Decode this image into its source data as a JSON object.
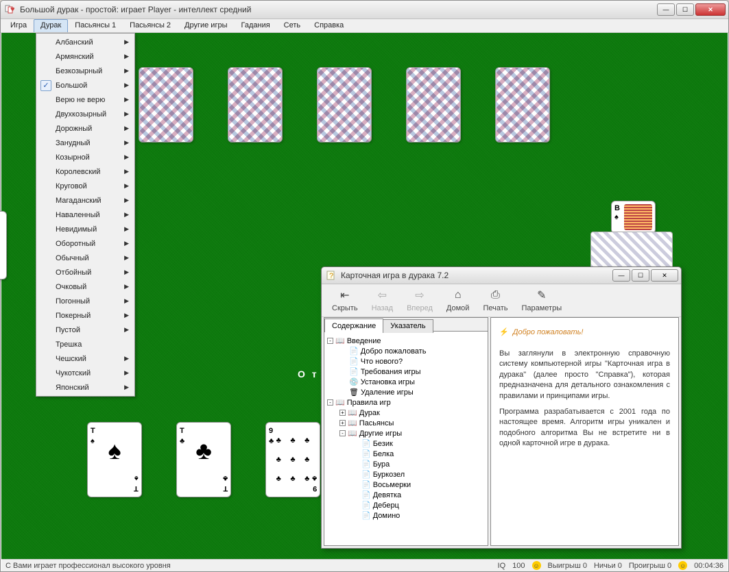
{
  "window": {
    "title": "Большой дурак - простой: играет Player - интеллект средний"
  },
  "menu": {
    "items": [
      "Игра",
      "Дурак",
      "Пасьянсы 1",
      "Пасьянсы 2",
      "Другие игры",
      "Гадания",
      "Сеть",
      "Справка"
    ],
    "active_index": 1
  },
  "dropdown": {
    "items": [
      {
        "label": "Албанский",
        "sub": true
      },
      {
        "label": "Армянский",
        "sub": true
      },
      {
        "label": "Безкозырный",
        "sub": true
      },
      {
        "label": "Большой",
        "sub": true,
        "checked": true
      },
      {
        "label": "Верю не верю",
        "sub": true
      },
      {
        "label": "Двухкозырный",
        "sub": true
      },
      {
        "label": "Дорожный",
        "sub": true
      },
      {
        "label": "Занудный",
        "sub": true
      },
      {
        "label": "Козырной",
        "sub": true
      },
      {
        "label": "Королевский",
        "sub": true
      },
      {
        "label": "Круговой",
        "sub": true
      },
      {
        "label": "Магаданский",
        "sub": true
      },
      {
        "label": "Наваленный",
        "sub": true
      },
      {
        "label": "Невидимый",
        "sub": true
      },
      {
        "label": "Оборотный",
        "sub": true
      },
      {
        "label": "Обычный",
        "sub": true
      },
      {
        "label": "Отбойный",
        "sub": true
      },
      {
        "label": "Очковый",
        "sub": true
      },
      {
        "label": "Погонный",
        "sub": true
      },
      {
        "label": "Покерный",
        "sub": true
      },
      {
        "label": "Пустой",
        "sub": true
      },
      {
        "label": "Трешка",
        "sub": false
      },
      {
        "label": "Чешский",
        "sub": true
      },
      {
        "label": "Чукотский",
        "sub": true
      },
      {
        "label": "Японский",
        "sub": true
      }
    ]
  },
  "game": {
    "center_text": "О т б",
    "player_cards": [
      {
        "rank": "Т",
        "suit": "♠",
        "suit_class": "spade"
      },
      {
        "rank": "Т",
        "suit": "♣",
        "suit_class": "club"
      },
      {
        "rank": "9",
        "suit": "♣",
        "suit_class": "club",
        "pips": 9
      }
    ],
    "trump": {
      "rank": "В",
      "suit": "♠"
    }
  },
  "help": {
    "title": "Карточная игра в дурака 7.2",
    "toolbar": [
      {
        "label": "Скрыть",
        "icon": "hide",
        "enabled": true
      },
      {
        "label": "Назад",
        "icon": "back",
        "enabled": false
      },
      {
        "label": "Вперед",
        "icon": "forward",
        "enabled": false
      },
      {
        "label": "Домой",
        "icon": "home",
        "enabled": true
      },
      {
        "label": "Печать",
        "icon": "print",
        "enabled": true
      },
      {
        "label": "Параметры",
        "icon": "options",
        "enabled": true
      }
    ],
    "tabs": {
      "active": "Содержание",
      "inactive": "Указатель"
    },
    "tree": [
      {
        "type": "book",
        "label": "Введение",
        "level": 0,
        "expand": "-"
      },
      {
        "type": "page",
        "label": "Добро пожаловать",
        "level": 1
      },
      {
        "type": "page",
        "label": "Что нового?",
        "level": 1
      },
      {
        "type": "page",
        "label": "Требования игры",
        "level": 1
      },
      {
        "type": "page",
        "label": "Установка игры",
        "level": 1,
        "icon": "install"
      },
      {
        "type": "page",
        "label": "Удаление игры",
        "level": 1,
        "icon": "delete"
      },
      {
        "type": "book",
        "label": "Правила игр",
        "level": 0,
        "expand": "-"
      },
      {
        "type": "book",
        "label": "Дурак",
        "level": 1,
        "expand": "+"
      },
      {
        "type": "book",
        "label": "Пасьянсы",
        "level": 1,
        "expand": "+"
      },
      {
        "type": "book",
        "label": "Другие игры",
        "level": 1,
        "expand": "-"
      },
      {
        "type": "page",
        "label": "Безик",
        "level": 2
      },
      {
        "type": "page",
        "label": "Белка",
        "level": 2
      },
      {
        "type": "page",
        "label": "Бура",
        "level": 2
      },
      {
        "type": "page",
        "label": "Буркозел",
        "level": 2
      },
      {
        "type": "page",
        "label": "Восьмерки",
        "level": 2
      },
      {
        "type": "page",
        "label": "Девятка",
        "level": 2
      },
      {
        "type": "page",
        "label": "Деберц",
        "level": 2
      },
      {
        "type": "page",
        "label": "Домино",
        "level": 2
      }
    ],
    "content": {
      "heading": "Добро пожаловать!",
      "lightning": "⚡",
      "p1": "Вы заглянули в электронную справочную систему компьютерной игры \"Карточная игра в дурака\" (далее просто \"Справка\"), которая предназначена для детального ознакомления с правилами и принципами игры.",
      "p2": "Программа разрабатывается с 2001 года по настоящее время. Алгоритм игры уникален и подобного алгоритма Вы не встретите ни в одной карточной игре в дурака."
    }
  },
  "status": {
    "left": "С Вами играет профессионал высокого уровня",
    "iq_label": "IQ",
    "iq_val": "100",
    "wins": "Выигрыш 0",
    "draws": "Ничьи 0",
    "losses": "Проигрыш 0",
    "time": "00:04:36"
  }
}
